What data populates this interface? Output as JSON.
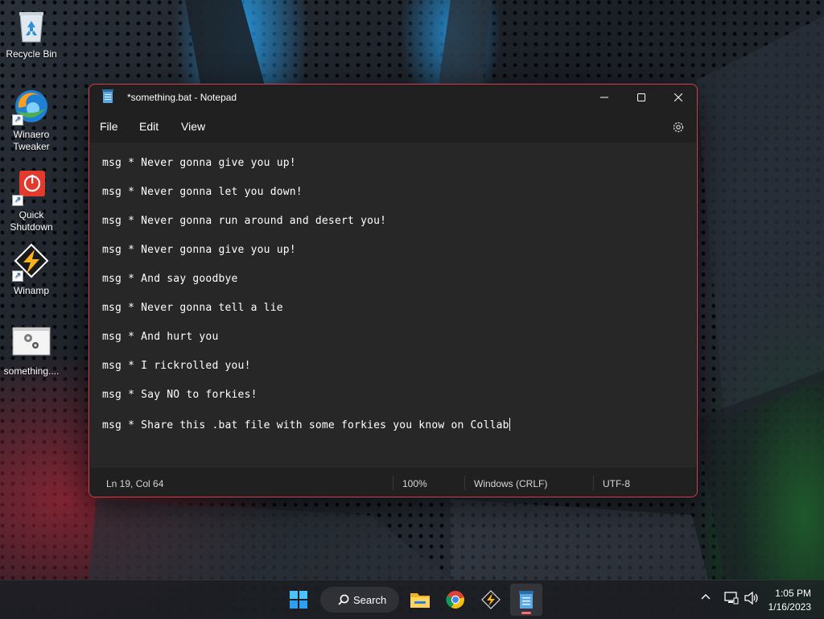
{
  "desktop": {
    "icons": [
      {
        "label": "Recycle Bin",
        "icon": "recycle-bin-icon"
      },
      {
        "label": "Winaero Tweaker",
        "icon": "winaero-tweaker-icon"
      },
      {
        "label": "Quick Shutdown",
        "icon": "power-icon"
      },
      {
        "label": "Winamp",
        "icon": "winamp-icon"
      },
      {
        "label": "something....",
        "icon": "batch-file-icon"
      }
    ]
  },
  "window": {
    "title": "*something.bat - Notepad",
    "accent_border": "#d33d4c",
    "menu": {
      "file": "File",
      "edit": "Edit",
      "view": "View"
    },
    "lines": [
      "msg * Never gonna give you up!",
      "msg * Never gonna let you down!",
      "msg * Never gonna run around and desert you!",
      "msg * Never gonna give you up!",
      "msg * And say goodbye",
      "msg * Never gonna tell a lie",
      "msg * And hurt you",
      "msg * I rickrolled you!",
      "msg * Say NO to forkies!",
      "msg * Share this .bat file with some forkies you know on Collab"
    ],
    "status": {
      "position": "Ln 19, Col 64",
      "zoom": "100%",
      "line_endings": "Windows (CRLF)",
      "encoding": "UTF-8"
    }
  },
  "taskbar": {
    "search_label": "Search",
    "apps": [
      "start-icon",
      "search-icon",
      "file-explorer-icon",
      "chrome-icon",
      "winamp-icon",
      "notepad-icon"
    ],
    "active_indicator_color": "#ff6b78",
    "clock": {
      "time": "1:05 PM",
      "date": "1/16/2023"
    }
  }
}
